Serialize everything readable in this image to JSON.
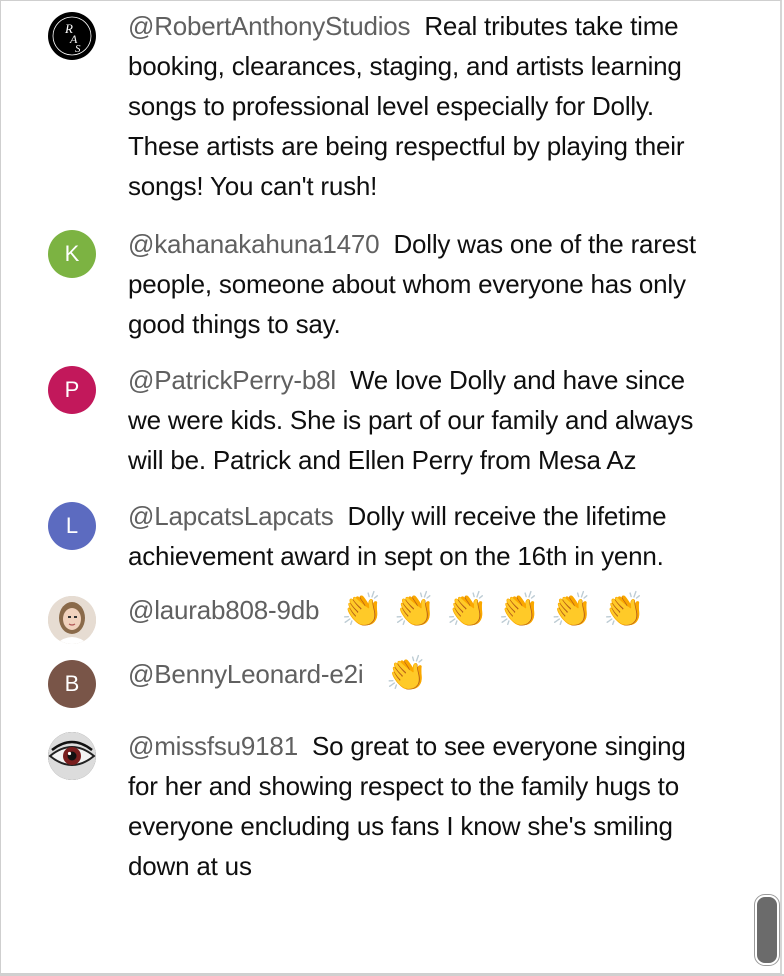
{
  "comments": [
    {
      "handle": "@RobertAnthonyStudios",
      "text": "Real tributes take time booking, clearances, staging, and artists learning songs to professional level especially for Dolly. These artists are being respectful by playing their songs! You can't rush!",
      "avatar": {
        "type": "logo",
        "letters": "RAS",
        "color": "#000000"
      }
    },
    {
      "handle": "@kahanakahuna1470",
      "text": "Dolly was one of the rarest people, someone about whom everyone has only good things to say.",
      "avatar": {
        "type": "initial",
        "letter": "K",
        "color": "#7cb342"
      }
    },
    {
      "handle": "@PatrickPerry-b8l",
      "text": "We love Dolly and have since we were kids. She is part of our family and always will be. Patrick and Ellen Perry from Mesa Az",
      "avatar": {
        "type": "initial",
        "letter": "P",
        "color": "#c2185b"
      }
    },
    {
      "handle": "@LapcatsLapcats",
      "text": "Dolly will receive the lifetime achievement award in sept on the 16th in yenn.",
      "avatar": {
        "type": "initial",
        "letter": "L",
        "color": "#5c6bc0"
      }
    },
    {
      "handle": "@laurab808-9db",
      "text": "👏👏👏👏👏👏",
      "avatar": {
        "type": "photo",
        "color": "#c9b8a4"
      }
    },
    {
      "handle": "@BennyLeonard-e2i",
      "text": "👏",
      "avatar": {
        "type": "initial",
        "letter": "B",
        "color": "#795548"
      }
    },
    {
      "handle": "@missfsu9181",
      "text": "So great to see everyone singing for her and showing respect to the family hugs to everyone encluding us fans I know she's smiling down at us",
      "avatar": {
        "type": "photo",
        "color": "#2b2b2b"
      }
    }
  ],
  "colors": {
    "handle": "#606060",
    "text": "#0f0f0f",
    "scrollbar": "#6b6b6b"
  }
}
